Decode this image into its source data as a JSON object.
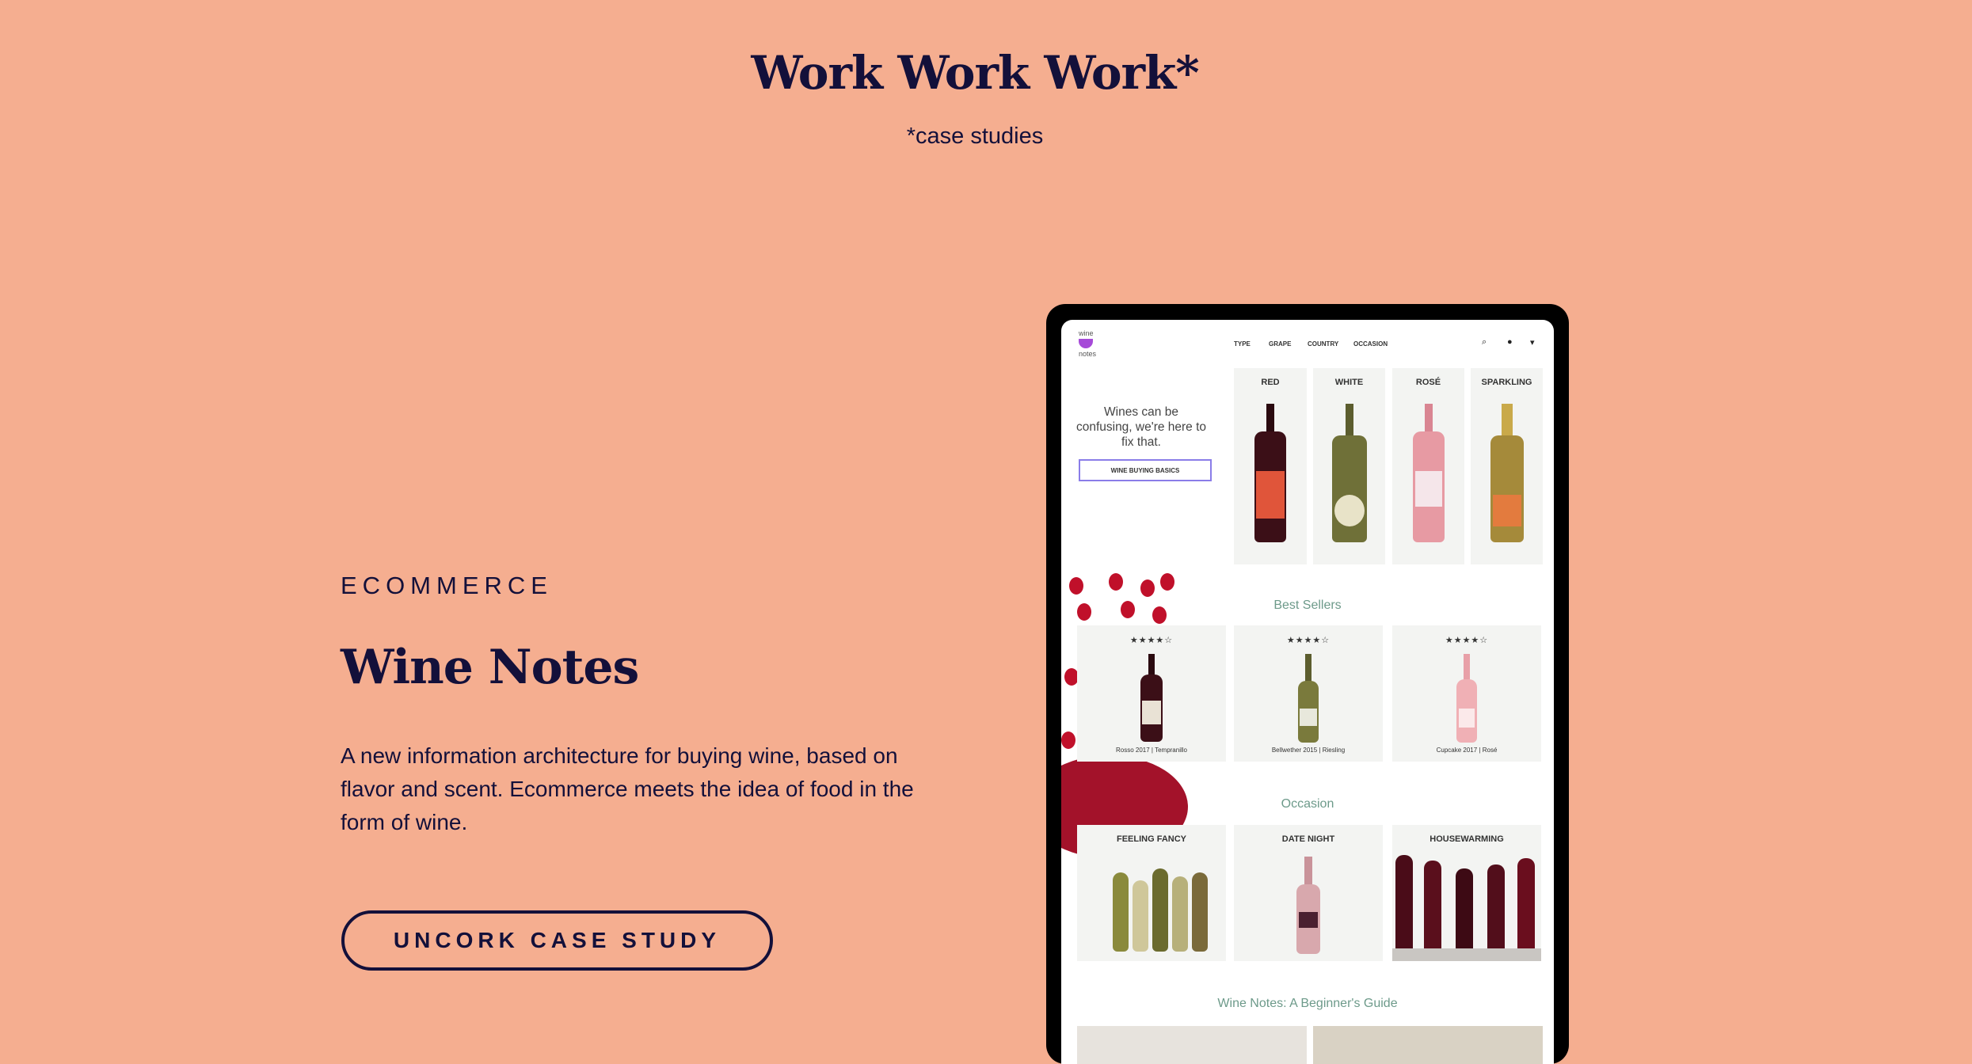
{
  "header": {
    "title": "Work Work Work*",
    "subtitle": "*case studies"
  },
  "project": {
    "category": "ECOMMERCE",
    "title": "Wine Notes",
    "description": "A new information architecture for buying wine, based on flavor and scent. Ecommerce meets the idea of food in the form of wine.",
    "cta_label": "UNCORK CASE STUDY"
  },
  "mockup": {
    "logo_top": "wine",
    "logo_bottom": "notes",
    "nav": [
      "TYPE",
      "GRAPE",
      "COUNTRY",
      "OCCASION"
    ],
    "nav_icons": [
      "search-icon",
      "user-icon",
      "cart-icon"
    ],
    "hero_text": "Wines can be confusing, we're here to fix that.",
    "hero_button": "WINE BUYING BASICS",
    "types": [
      {
        "label": "RED",
        "color": "#3b0f17"
      },
      {
        "label": "WHITE",
        "color": "#6f7038"
      },
      {
        "label": "ROSÉ",
        "color": "#e79aa3"
      },
      {
        "label": "SPARKLING",
        "color": "#a58a3a"
      }
    ],
    "best_sellers_title": "Best Sellers",
    "best_sellers": [
      {
        "stars": "★★★★☆",
        "caption": "Rosso 2017 | Tempranillo"
      },
      {
        "stars": "★★★★☆",
        "caption": "Bellwether 2015 | Riesling"
      },
      {
        "stars": "★★★★☆",
        "caption": "Cupcake 2017 | Rosé"
      }
    ],
    "occasion_title": "Occasion",
    "occasions": [
      "FEELING FANCY",
      "DATE NIGHT",
      "HOUSEWARMING"
    ],
    "guide_title": "Wine Notes: A Beginner's Guide"
  }
}
